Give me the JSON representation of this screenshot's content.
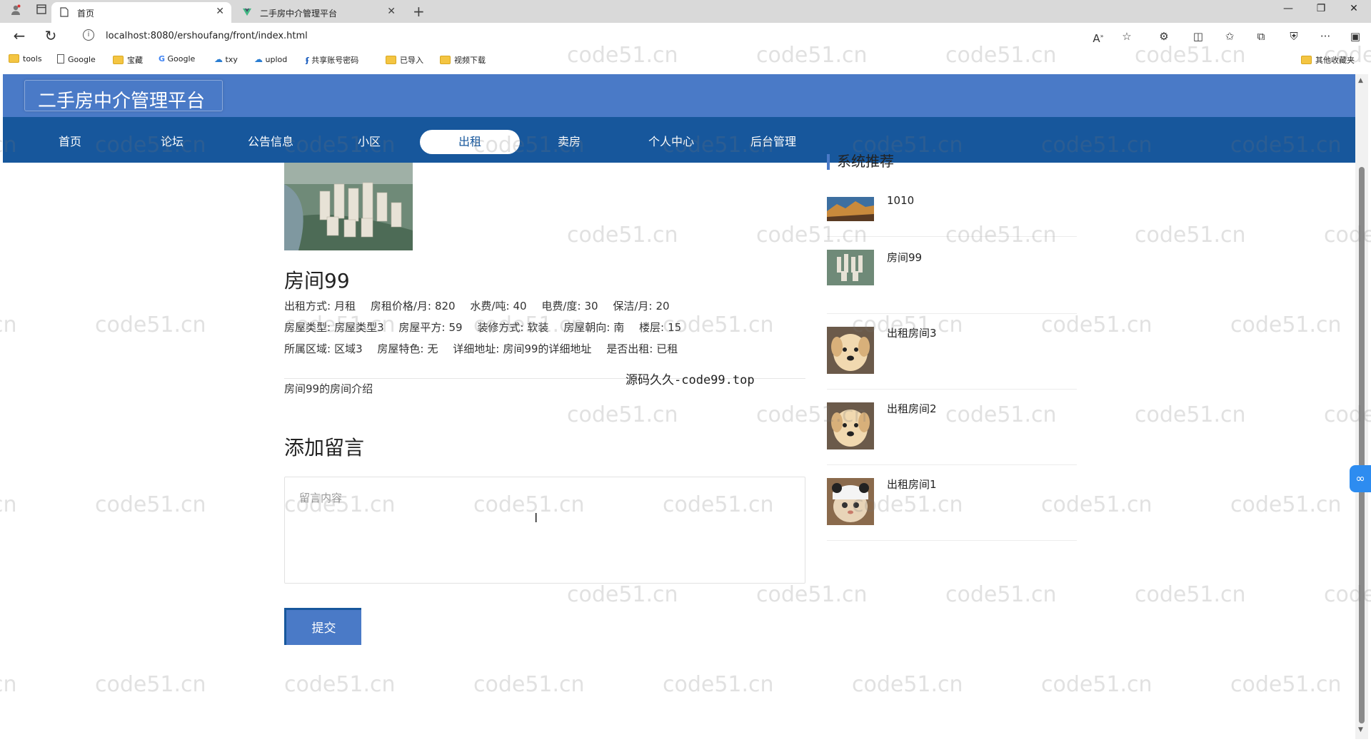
{
  "browser": {
    "tabs": [
      {
        "title": "首页",
        "active": true
      },
      {
        "title": "二手房中介管理平台",
        "active": false
      }
    ],
    "url": "localhost:8080/ershoufang/front/index.html",
    "bookmarks": [
      {
        "label": "tools",
        "icon": "folder-icon"
      },
      {
        "label": "Google",
        "icon": "document-icon"
      },
      {
        "label": "宝藏",
        "icon": "folder-icon"
      },
      {
        "label": "Google",
        "icon": "google-icon"
      },
      {
        "label": "txy",
        "icon": "cloud-icon"
      },
      {
        "label": "uplod",
        "icon": "cloud-icon"
      },
      {
        "label": "共享账号密码",
        "icon": "app-icon"
      },
      {
        "label": "已导入",
        "icon": "folder-icon"
      },
      {
        "label": "视频下载",
        "icon": "folder-icon"
      }
    ],
    "other_bookmarks": "其他收藏夹"
  },
  "site": {
    "title": "二手房中介管理平台",
    "nav": [
      {
        "label": "首页",
        "active": false
      },
      {
        "label": "论坛",
        "active": false
      },
      {
        "label": "公告信息",
        "active": false
      },
      {
        "label": "小区",
        "active": false
      },
      {
        "label": "出租",
        "active": true
      },
      {
        "label": "卖房",
        "active": false
      },
      {
        "label": "个人中心",
        "active": false
      },
      {
        "label": "后台管理",
        "active": false
      }
    ]
  },
  "detail": {
    "title": "房间99",
    "rows": [
      [
        {
          "label": "出租方式:",
          "value": "月租"
        },
        {
          "label": "房租价格/月:",
          "value": "820"
        },
        {
          "label": "水费/吨:",
          "value": "40"
        },
        {
          "label": "电费/度:",
          "value": "30"
        },
        {
          "label": "保洁/月:",
          "value": "20"
        }
      ],
      [
        {
          "label": "房屋类型:",
          "value": "房屋类型3"
        },
        {
          "label": "房屋平方:",
          "value": "59"
        },
        {
          "label": "装修方式:",
          "value": "软装"
        },
        {
          "label": "房屋朝向:",
          "value": "南"
        },
        {
          "label": "楼层:",
          "value": "15"
        }
      ],
      [
        {
          "label": "所属区域:",
          "value": "区域3"
        },
        {
          "label": "房屋特色:",
          "value": "无"
        },
        {
          "label": "详细地址:",
          "value": "房间99的详细地址"
        },
        {
          "label": "是否出租:",
          "value": "已租"
        }
      ]
    ],
    "intro": "房间99的房间介绍",
    "overlay_text": "源码久久-code99.top"
  },
  "message": {
    "title": "添加留言",
    "placeholder": "留言内容",
    "submit_label": "提交"
  },
  "recommend": {
    "title": "系统推荐",
    "items": [
      {
        "name": "1010",
        "thumb": "mountain"
      },
      {
        "name": "房间99",
        "thumb": "building"
      },
      {
        "name": "出租房间3",
        "thumb": "dog"
      },
      {
        "name": "出租房间2",
        "thumb": "dog"
      },
      {
        "name": "出租房间1",
        "thumb": "cat"
      }
    ]
  },
  "watermark": "code51.cn",
  "colors": {
    "header": "#4a7ac7",
    "nav": "#17579c",
    "accent": "#4a7ac7"
  }
}
